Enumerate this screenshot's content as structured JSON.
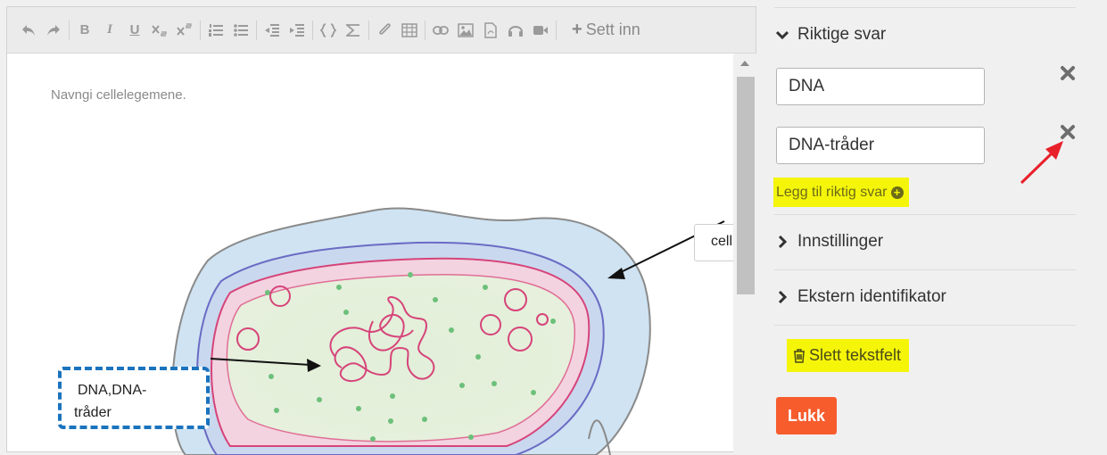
{
  "toolbar": {
    "icons": [
      "undo-icon",
      "redo-icon",
      "bold-icon",
      "italic-icon",
      "underline-icon",
      "subscript-icon",
      "superscript-icon",
      "ordered-list-icon",
      "bullet-list-icon",
      "outdent-icon",
      "indent-icon",
      "code-icon",
      "math-icon",
      "attachment-icon",
      "table-icon",
      "link-icon",
      "image-icon",
      "pdf-icon",
      "audio-icon",
      "video-icon"
    ],
    "bold_glyph": "B",
    "italic_glyph": "I",
    "underline_glyph": "U",
    "insert_label": "Sett inn",
    "insert_plus": "+"
  },
  "editor": {
    "description": "Navngi cellelegemene.",
    "labels": {
      "cell": "cell",
      "dna_line1": "DNA,DNA-",
      "dna_line2": "tråder"
    }
  },
  "panel": {
    "correct_answers_title": "Riktige svar",
    "answers": [
      "DNA",
      "DNA-tråder"
    ],
    "add_answer_label": "Legg til riktig svar",
    "settings_title": "Innstillinger",
    "external_id_title": "Ekstern identifikator",
    "delete_label": "Slett tekstfelt",
    "close_label": "Lukk"
  },
  "colors": {
    "highlight": "#f5f50a",
    "close_button": "#f75c2d",
    "dashed_border": "#1a73bd",
    "annotation_arrow": "#e8202a"
  }
}
